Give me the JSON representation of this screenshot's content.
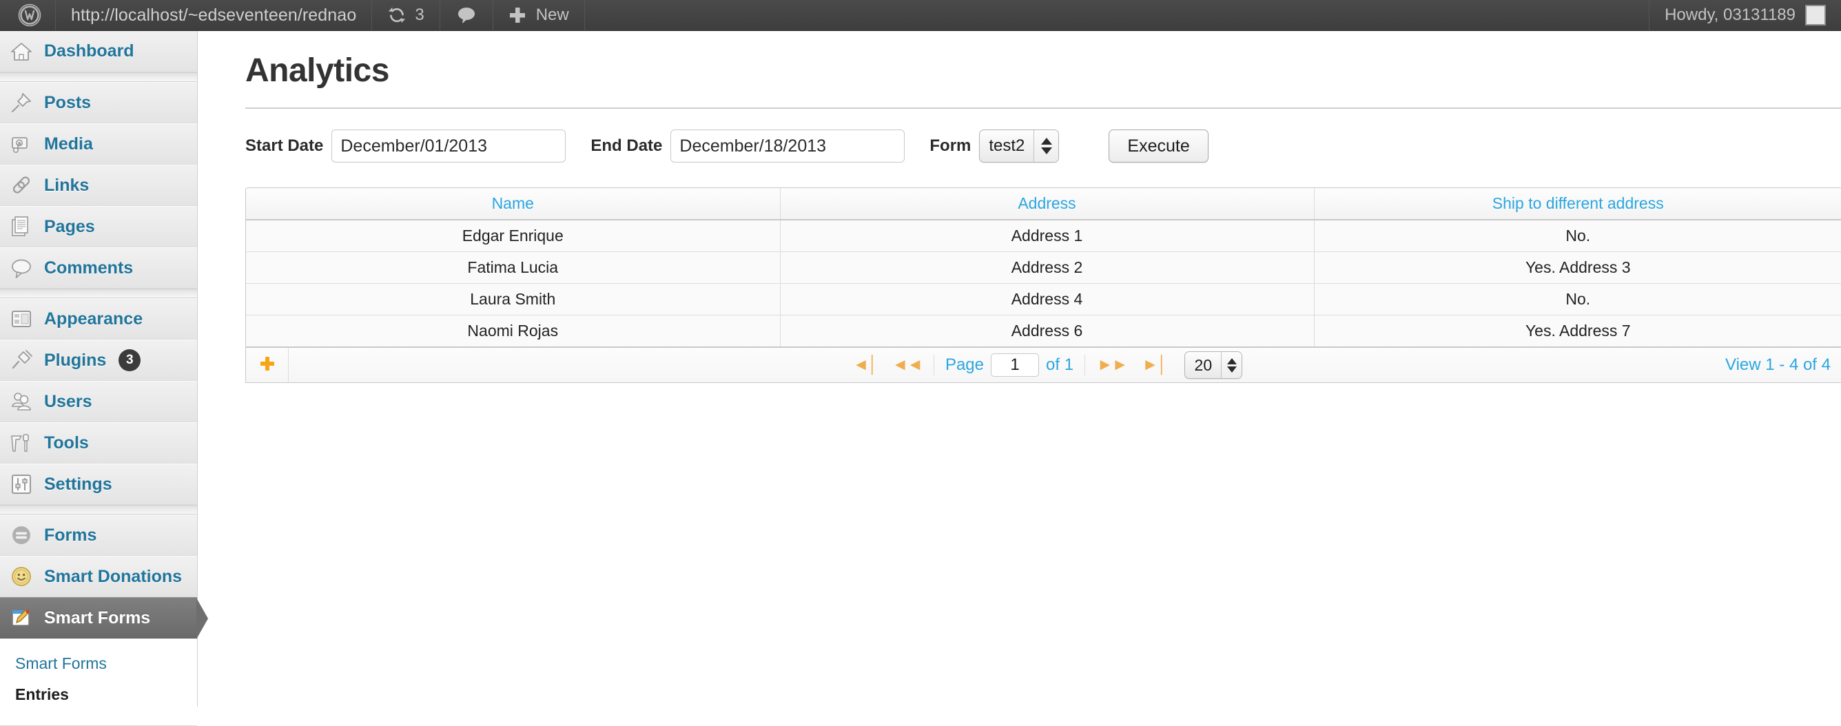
{
  "adminbar": {
    "logo_icon": "wordpress-logo-icon",
    "site_url": "http://localhost/~edseventeen/rednao",
    "updates": {
      "icon": "updates-icon",
      "count": "3"
    },
    "comments": {
      "icon": "comments-bubble-icon"
    },
    "new": {
      "icon": "plus-icon",
      "label": "New"
    },
    "account": {
      "greeting": "Howdy, 03131189",
      "avatar_icon": "avatar-icon"
    }
  },
  "sidebar": {
    "items": [
      {
        "label": "Dashboard",
        "icon": "dashboard-home-icon",
        "current": false,
        "badge": null
      },
      {
        "label": "Posts",
        "icon": "posts-pin-icon",
        "current": false,
        "badge": null
      },
      {
        "label": "Media",
        "icon": "media-camera-icon",
        "current": false,
        "badge": null
      },
      {
        "label": "Links",
        "icon": "links-chain-icon",
        "current": false,
        "badge": null
      },
      {
        "label": "Pages",
        "icon": "pages-document-icon",
        "current": false,
        "badge": null
      },
      {
        "label": "Comments",
        "icon": "comments-bubble-icon",
        "current": false,
        "badge": null
      },
      {
        "label": "Appearance",
        "icon": "appearance-layout-icon",
        "current": false,
        "badge": null
      },
      {
        "label": "Plugins",
        "icon": "plugins-plug-icon",
        "current": false,
        "badge": "3"
      },
      {
        "label": "Users",
        "icon": "users-people-icon",
        "current": false,
        "badge": null
      },
      {
        "label": "Tools",
        "icon": "tools-hammer-icon",
        "current": false,
        "badge": null
      },
      {
        "label": "Settings",
        "icon": "settings-sliders-icon",
        "current": false,
        "badge": null
      },
      {
        "label": "Forms",
        "icon": "forms-circle-icon",
        "current": false,
        "badge": null
      },
      {
        "label": "Smart Donations",
        "icon": "smart-donations-smiley-icon",
        "current": false,
        "badge": null
      },
      {
        "label": "Smart Forms",
        "icon": "smart-forms-pencil-icon",
        "current": true,
        "badge": null
      }
    ],
    "submenu": [
      {
        "label": "Smart Forms",
        "current": false
      },
      {
        "label": "Entries",
        "current": true
      }
    ]
  },
  "main": {
    "page_title": "Analytics",
    "filters": {
      "start_date_label": "Start Date",
      "start_date_value": "December/01/2013",
      "start_date_placeholder": "",
      "end_date_label": "End Date",
      "end_date_value": "December/18/2013",
      "end_date_placeholder": "",
      "form_label": "Form",
      "form_value": "test2",
      "form_options": [
        "test2"
      ],
      "execute_label": "Execute"
    },
    "table": {
      "columns": [
        "Name",
        "Address",
        "Ship to different address"
      ],
      "rows": [
        [
          "Edgar Enrique",
          "Address 1",
          "No."
        ],
        [
          "Fatima Lucia",
          "Address 2",
          "Yes. Address 3"
        ],
        [
          "Laura Smith",
          "Address 4",
          "No."
        ],
        [
          "Naomi Rojas",
          "Address 6",
          "Yes. Address 7"
        ]
      ]
    },
    "footer": {
      "add_icon": "plus-icon",
      "first_page_icon": "first-page-icon",
      "prev_page_icon": "previous-page-icon",
      "next_page_icon": "next-page-icon",
      "last_page_icon": "last-page-icon",
      "page_label": "Page",
      "page_value": "1",
      "of_label": "of 1",
      "page_size_value": "20",
      "page_size_options": [
        "20"
      ],
      "view_range": "View 1 - 4 of 4"
    }
  },
  "colors": {
    "adminbar_bg": "#464646",
    "sidebar_link": "#21759b",
    "current_menu_bg": "#6f6e6e",
    "table_header_link": "#2ba6e0",
    "pager_arrow": "#f0ad4e",
    "badge_bg": "#3b3b3b"
  }
}
